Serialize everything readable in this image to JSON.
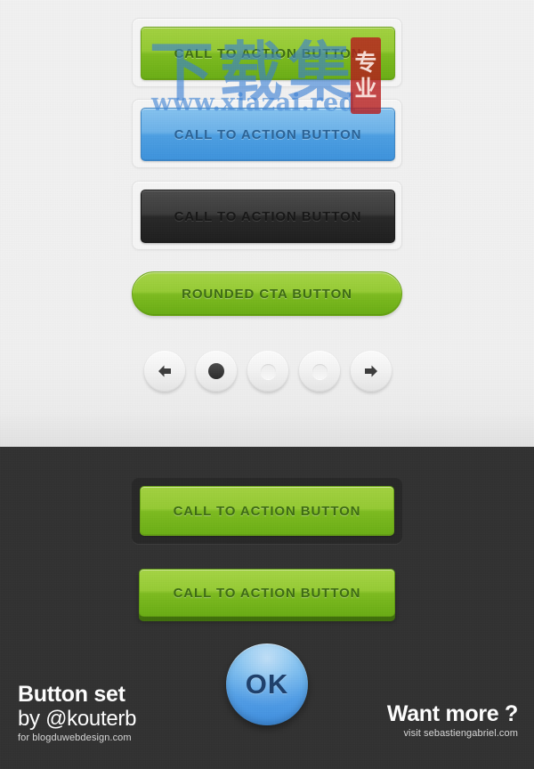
{
  "theme": {
    "light_bg": "#f1f1f1",
    "dark_bg": "#313131",
    "green": "#7cbb1e",
    "blue": "#4c9fe3",
    "dark_btn": "#262626",
    "ok_blue": "#4f9ce6",
    "stamp_red": "#b61a1a",
    "watermark_blue": "#3880d6"
  },
  "light_section": {
    "buttons": [
      {
        "id": "green-cta",
        "label": "CALL TO ACTION BUTTON",
        "style": "green-rect",
        "framed": true
      },
      {
        "id": "blue-cta",
        "label": "CALL TO ACTION BUTTON",
        "style": "blue-rect",
        "framed": true
      },
      {
        "id": "dark-cta",
        "label": "CALL TO ACTION BUTTON",
        "style": "dark-rect",
        "framed": true
      },
      {
        "id": "rounded-cta",
        "label": "ROUNDED CTA BUTTON",
        "style": "green-pill",
        "framed": false
      }
    ],
    "circle_buttons": [
      {
        "id": "prev",
        "icon": "arrow-left-icon"
      },
      {
        "id": "radio-selected",
        "icon": "dot-filled-icon"
      },
      {
        "id": "radio-empty-1",
        "icon": "circle-empty-icon"
      },
      {
        "id": "radio-empty-2",
        "icon": "circle-empty-icon"
      },
      {
        "id": "next",
        "icon": "arrow-right-icon"
      }
    ]
  },
  "dark_section": {
    "buttons": [
      {
        "id": "dark-green-framed",
        "label": "CALL TO ACTION BUTTON",
        "style": "green-framed"
      },
      {
        "id": "dark-green-3d",
        "label": "CALL TO ACTION BUTTON",
        "style": "green-3d"
      }
    ],
    "ok_button": {
      "label": "OK"
    }
  },
  "footer": {
    "left": {
      "title": "Button set",
      "subtitle": "by @kouterb",
      "small": "for blogduwebdesign.com"
    },
    "right": {
      "title": "Want more ?",
      "small": "visit sebastiengabriel.com"
    }
  },
  "watermark": {
    "chinese": "下载集",
    "url": "www.xiazai.red",
    "stamp_top": "专",
    "stamp_bottom": "业"
  }
}
